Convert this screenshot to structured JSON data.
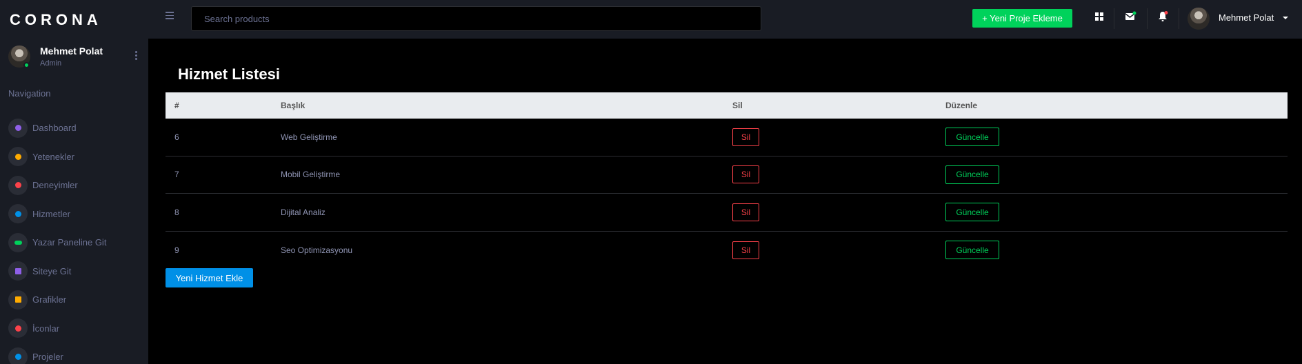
{
  "brand": "CORONA",
  "profile": {
    "name": "Mehmet Polat",
    "role": "Admin"
  },
  "nav_label": "Navigation",
  "nav": [
    {
      "label": "Dashboard",
      "icon": "speedometer-icon",
      "color": "#8f5fe8"
    },
    {
      "label": "Yetenekler",
      "icon": "star-icon",
      "color": "#ffab00"
    },
    {
      "label": "Deneyimler",
      "icon": "check-circle-icon",
      "color": "#fc424a"
    },
    {
      "label": "Hizmetler",
      "icon": "check-circle-icon",
      "color": "#0090e7"
    },
    {
      "label": "Yazar Paneline Git",
      "icon": "link-icon",
      "color": "#00d25b"
    },
    {
      "label": "Siteye Git",
      "icon": "grid-icon",
      "color": "#8f5fe8"
    },
    {
      "label": "Grafikler",
      "icon": "chart-icon",
      "color": "#ffab00"
    },
    {
      "label": "İconlar",
      "icon": "pin-icon",
      "color": "#fc424a"
    },
    {
      "label": "Projeler",
      "icon": "github-icon",
      "color": "#0090e7"
    }
  ],
  "topbar": {
    "search_placeholder": "Search products",
    "cta_label": "+ Yeni Proje Ekleme",
    "user_name": "Mehmet Polat"
  },
  "page_title": "Hizmet Listesi",
  "table": {
    "headers": [
      "#",
      "Başlık",
      "Sil",
      "Düzenle"
    ],
    "rows": [
      {
        "id": "6",
        "title": "Web Geliştirme",
        "delete": "Sil",
        "update": "Güncelle"
      },
      {
        "id": "7",
        "title": "Mobil Geliştirme",
        "delete": "Sil",
        "update": "Güncelle"
      },
      {
        "id": "8",
        "title": "Dijital Analiz",
        "delete": "Sil",
        "update": "Güncelle"
      },
      {
        "id": "9",
        "title": "Seo Optimizasyonu",
        "delete": "Sil",
        "update": "Güncelle"
      }
    ]
  },
  "add_button": "Yeni Hizmet Ekle",
  "colors": {
    "success": "#00d25b",
    "danger": "#fc424a",
    "primary": "#0090e7",
    "sidebar_bg": "#191c24"
  }
}
